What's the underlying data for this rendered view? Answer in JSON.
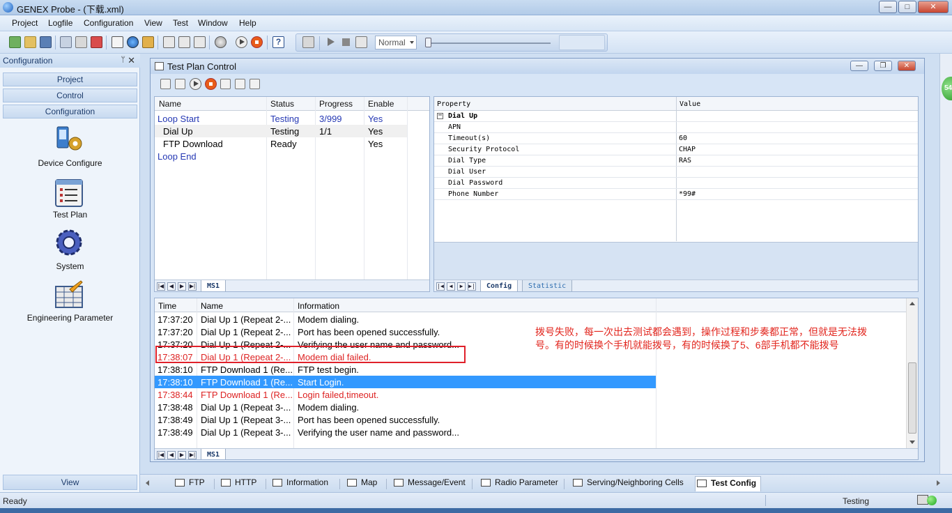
{
  "window": {
    "title": "GENEX Probe - (下载.xml)"
  },
  "menu": [
    "Project",
    "Logfile",
    "Configuration",
    "View",
    "Test",
    "Window",
    "Help"
  ],
  "toolbar": {
    "mode_combo": "Normal"
  },
  "left_panel": {
    "title": "Configuration",
    "categories": [
      "Project",
      "Control",
      "Configuration"
    ],
    "items": [
      "Device Configure",
      "Test Plan",
      "System",
      "Engineering Parameter"
    ],
    "view_label": "View"
  },
  "child_window": {
    "title": "Test Plan Control"
  },
  "test_plan": {
    "columns": [
      "Name",
      "Status",
      "Progress",
      "Enable"
    ],
    "rows": [
      {
        "name": "Loop Start",
        "status": "Testing",
        "progress": "3/999",
        "enable": "Yes"
      },
      {
        "name": "Dial Up",
        "status": "Testing",
        "progress": "1/1",
        "enable": "Yes"
      },
      {
        "name": "FTP Download",
        "status": "Ready",
        "progress": "",
        "enable": "Yes"
      },
      {
        "name": "Loop End",
        "status": "",
        "progress": "",
        "enable": ""
      }
    ],
    "sheet_tab": "MS1"
  },
  "properties": {
    "columns": [
      "Property",
      "Value"
    ],
    "group": "Dial Up",
    "rows": [
      {
        "property": "APN",
        "value": ""
      },
      {
        "property": "Timeout(s)",
        "value": "60"
      },
      {
        "property": "Security Protocol",
        "value": "CHAP"
      },
      {
        "property": "Dial Type",
        "value": "RAS"
      },
      {
        "property": "Dial User",
        "value": ""
      },
      {
        "property": "Dial Password",
        "value": ""
      },
      {
        "property": "Phone Number",
        "value": "*99#"
      }
    ],
    "tabs": [
      "Config",
      "Statistic"
    ]
  },
  "log": {
    "columns": [
      "Time",
      "Name",
      "Information"
    ],
    "rows": [
      {
        "time": "17:37:20",
        "name": "Dial Up 1 (Repeat 2-...",
        "info": "Modem dialing."
      },
      {
        "time": "17:37:20",
        "name": "Dial Up 1 (Repeat 2-...",
        "info": "Port has been opened successfully."
      },
      {
        "time": "17:37:20",
        "name": "Dial Up 1 (Repeat 2-...",
        "info": "Verifying the user name and password..."
      },
      {
        "time": "17:38:07",
        "name": "Dial Up 1 (Repeat 2-...",
        "info": "Modem dial failed."
      },
      {
        "time": "17:38:10",
        "name": "FTP Download 1 (Re...",
        "info": "FTP test begin."
      },
      {
        "time": "17:38:10",
        "name": "FTP Download 1 (Re...",
        "info": "Start Login."
      },
      {
        "time": "17:38:44",
        "name": "FTP Download 1 (Re...",
        "info": "Login failed,timeout."
      },
      {
        "time": "17:38:48",
        "name": "Dial Up 1 (Repeat 3-...",
        "info": "Modem dialing."
      },
      {
        "time": "17:38:49",
        "name": "Dial Up 1 (Repeat 3-...",
        "info": "Port has been opened successfully."
      },
      {
        "time": "17:38:49",
        "name": "Dial Up 1 (Repeat 3-...",
        "info": "Verifying the user name and password..."
      }
    ],
    "sheet_tab": "MS1"
  },
  "annotation": "拨号失败，每一次出去测试都会遇到，操作过程和步奏都正常，但就是无法拨号。有的时候换个手机就能拨号，有的时候换了5、6部手机都不能拨号",
  "bottom_tabs": [
    "FTP",
    "HTTP",
    "Information",
    "Map",
    "Message/Event",
    "Radio Parameter",
    "Serving/Neighboring Cells",
    "Test Config"
  ],
  "status": {
    "left": "Ready",
    "right": "Testing"
  },
  "side_badge": "54"
}
